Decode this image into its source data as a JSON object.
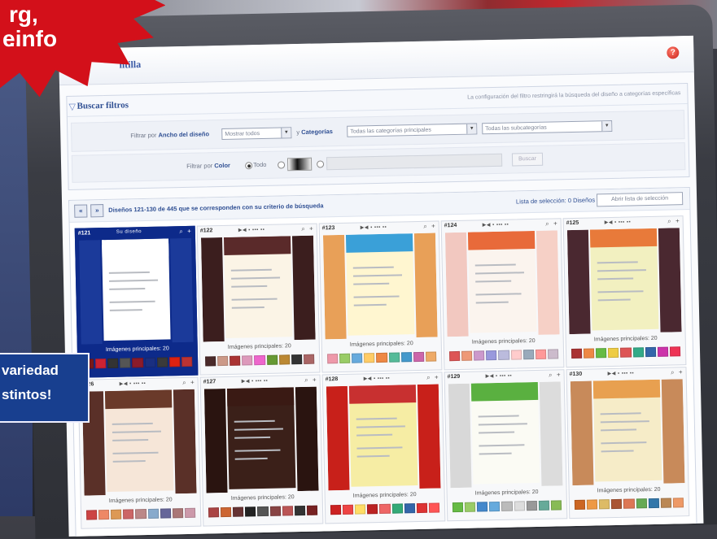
{
  "promo": {
    "burst_line1": "rg, .info",
    "burst_line2": "e.",
    "banner_line1": "variedad",
    "banner_line2": "stintos!"
  },
  "window": {
    "title": "ntilla",
    "help_icon": "?"
  },
  "filters": {
    "title": "Buscar filtros",
    "note": "La configuración del filtro restringirá la búsqueda del diseño a categorías específicas",
    "filter_by_1": "Filtrar por",
    "width_label": "Ancho del diseño",
    "width_select": "Mostrar todos",
    "and": "y",
    "categories_label": "Categorías",
    "categories_select": "Todas las categorías principales",
    "subcategories_select": "Todas las subcategorías",
    "filter_by_2": "Filtrar por",
    "color_label": "Color",
    "color_all": "Todo",
    "ok_button": "Buscar"
  },
  "results": {
    "prev_icon": "«",
    "next_icon": "»",
    "summary": "Diseños 121-130 de 445 que se corresponden con su criterio de búsqueda",
    "selection_list": "Lista de selección: 0 Diseños",
    "selection_button": "Abrir lista de selección"
  },
  "cards": [
    {
      "id": "#121",
      "tool": "Su diseño",
      "caption": "Imágenes principales: 20",
      "colors": {
        "l": "#1b3a9a",
        "r": "#1b3a9a",
        "hdr": "#ffffff",
        "page": "#ffffff"
      },
      "swatches": [
        "#7a1a1a",
        "#c23",
        "#333",
        "#555",
        "#8b1b2a",
        "#1a2f80",
        "#3a3a3a",
        "#d21",
        "#b33"
      ]
    },
    {
      "id": "#122",
      "tool": "▶◀ ▪ ▪▪▪ ▪▪",
      "caption": "Imágenes principales: 20",
      "colors": {
        "l": "#3b1e1e",
        "r": "#3b1e1e",
        "hdr": "#5a2a2a",
        "page": "#fbf4e6"
      },
      "swatches": [
        "#4a2a2a",
        "#c98",
        "#a33",
        "#d9b",
        "#e6c",
        "#693",
        "#b83",
        "#333",
        "#a66"
      ]
    },
    {
      "id": "#123",
      "tool": "▶◀ ▪ ▪▪▪ ▪▪",
      "caption": "Imágenes principales: 20",
      "colors": {
        "l": "#e8a058",
        "r": "#e8a058",
        "hdr": "#3aa0d8",
        "page": "#fff6d0"
      },
      "swatches": [
        "#e9a",
        "#9c6",
        "#6ad",
        "#fc6",
        "#e84",
        "#5b9",
        "#49c",
        "#c6a",
        "#ea6"
      ]
    },
    {
      "id": "#124",
      "tool": "▶◀ ▪ ▪▪▪ ▪▪",
      "caption": "Imágenes principales: 20",
      "colors": {
        "l": "#f2c8c0",
        "r": "#f6d0c6",
        "hdr": "#e86a3a",
        "page": "#fbf4ee"
      },
      "swatches": [
        "#d55",
        "#e97",
        "#c9c",
        "#99d",
        "#bbd",
        "#fcc",
        "#9ab",
        "#f99",
        "#cbc"
      ]
    },
    {
      "id": "#125",
      "tool": "▶◀ ▪ ▪▪▪ ▪▪",
      "caption": "Imágenes principales: 20",
      "colors": {
        "l": "#4a2830",
        "r": "#4a2830",
        "hdr": "#e87a3a",
        "page": "#f2f0c0"
      },
      "swatches": [
        "#a33",
        "#e84",
        "#6b4",
        "#ec4",
        "#d55",
        "#3a8",
        "#36a",
        "#c3a",
        "#e35"
      ]
    },
    {
      "id": "#126",
      "tool": "▶◀ ▪ ▪▪▪ ▪▪",
      "caption": "Imágenes principales: 20",
      "colors": {
        "l": "#5a3028",
        "r": "#5a3028",
        "hdr": "#6a3a2a",
        "page": "#f6e6d8"
      },
      "swatches": [
        "#c44",
        "#e86",
        "#d95",
        "#c66",
        "#b88",
        "#8ac",
        "#669",
        "#a77",
        "#c9a"
      ]
    },
    {
      "id": "#127",
      "tool": "▶◀ ▪ ▪▪▪ ▪▪",
      "caption": "Imágenes principales: 20",
      "colors": {
        "l": "#2a1410",
        "r": "#2a1410",
        "hdr": "#3a1a14",
        "page": "#3b2019"
      },
      "swatches": [
        "#a44",
        "#c63",
        "#633",
        "#222",
        "#555",
        "#844",
        "#b55",
        "#333",
        "#722"
      ]
    },
    {
      "id": "#128",
      "tool": "▶◀ ▪ ▪▪▪ ▪▪",
      "caption": "Imágenes principales: 20",
      "colors": {
        "l": "#c8201a",
        "r": "#c8201a",
        "hdr": "#c83030",
        "page": "#f6eda4"
      },
      "swatches": [
        "#c22",
        "#e44",
        "#fd6",
        "#b22",
        "#e66",
        "#3a7",
        "#36a",
        "#d33",
        "#f55"
      ]
    },
    {
      "id": "#129",
      "tool": "▶◀ ▪ ▪▪▪ ▪▪",
      "caption": "Imágenes principales: 20",
      "colors": {
        "l": "#d8d8d8",
        "r": "#dcdcdc",
        "hdr": "#5ab040",
        "page": "#fbfbf4"
      },
      "swatches": [
        "#6b4",
        "#9c6",
        "#48c",
        "#6ad",
        "#bbb",
        "#ddd",
        "#999",
        "#6a9",
        "#8b5"
      ]
    },
    {
      "id": "#130",
      "tool": "▶◀ ▪ ▪▪▪ ▪▪",
      "caption": "Imágenes principales: 20",
      "colors": {
        "l": "#c88a5a",
        "r": "#c88a5a",
        "hdr": "#e8a050",
        "page": "#f6ecc8"
      },
      "swatches": [
        "#c62",
        "#e94",
        "#db6",
        "#a53",
        "#d75",
        "#6a5",
        "#37a",
        "#b85",
        "#e96"
      ]
    }
  ]
}
